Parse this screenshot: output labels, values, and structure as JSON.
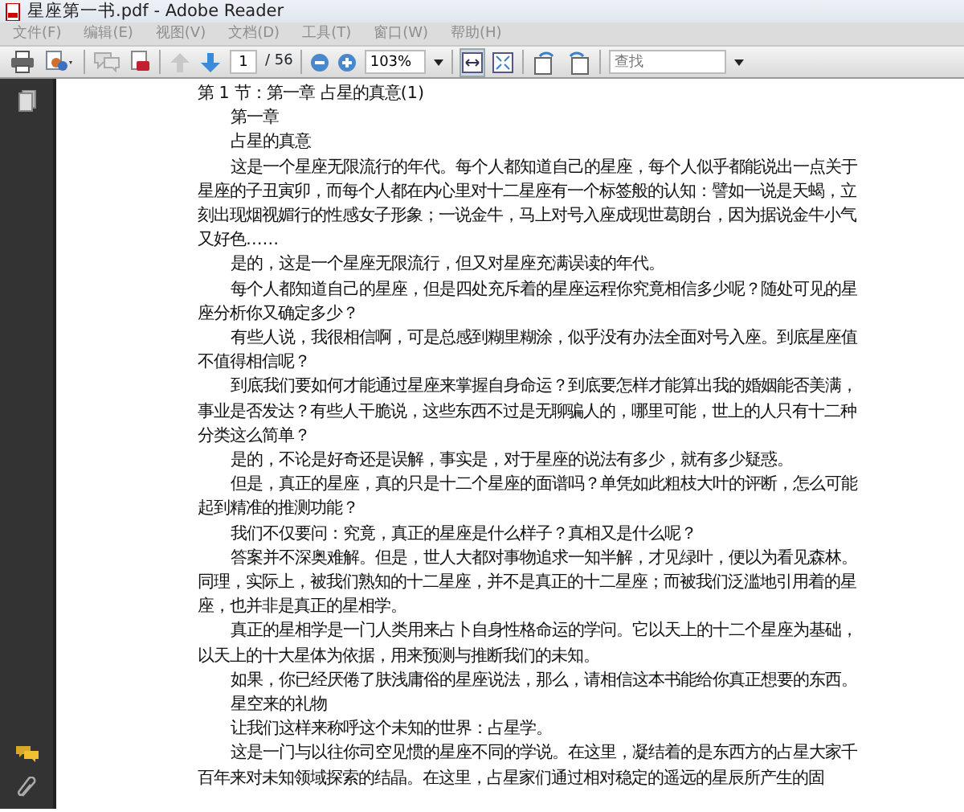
{
  "window": {
    "title": "星座第一书.pdf - Adobe Reader"
  },
  "menu": [
    {
      "label": "文件(F)",
      "disabled": true
    },
    {
      "label": "编辑(E)",
      "disabled": true
    },
    {
      "label": "视图(V)",
      "disabled": true
    },
    {
      "label": "文档(D)",
      "disabled": true
    },
    {
      "label": "工具(T)",
      "disabled": true
    },
    {
      "label": "窗口(W)",
      "disabled": true
    },
    {
      "label": "帮助(H)",
      "disabled": true
    }
  ],
  "toolbar": {
    "page": "1",
    "page_count": "/ 56",
    "zoom": "103%",
    "search": {
      "placeholder": "查找"
    },
    "fit_width_selected": true
  },
  "document": {
    "paragraphs": [
      {
        "kind": "heading",
        "text": "第 1 节：第一章  占星的真意(1)"
      },
      {
        "kind": "para",
        "text": "第一章"
      },
      {
        "kind": "para",
        "text": "占星的真意"
      },
      {
        "kind": "para",
        "text": "这是一个星座无限流行的年代。每个人都知道自己的星座，每个人似乎都能说出一点关于星座的子丑寅卯，而每个人都在内心里对十二星座有一个标签般的认知：譬如一说是天蝎，立刻出现烟视媚行的性感女子形象；一说金牛，马上对号入座成现世葛朗台，因为据说金牛小气又好色……"
      },
      {
        "kind": "para",
        "text": "是的，这是一个星座无限流行，但又对星座充满误读的年代。"
      },
      {
        "kind": "para",
        "text": "每个人都知道自己的星座，但是四处充斥着的星座运程你究竟相信多少呢？随处可见的星座分析你又确定多少？"
      },
      {
        "kind": "para",
        "text": "有些人说，我很相信啊，可是总感到糊里糊涂，似乎没有办法全面对号入座。到底星座值不值得相信呢？"
      },
      {
        "kind": "para",
        "text": "到底我们要如何才能通过星座来掌握自身命运？到底要怎样才能算出我的婚姻能否美满，事业是否发达？有些人干脆说，这些东西不过是无聊骗人的，哪里可能，世上的人只有十二种分类这么简单？"
      },
      {
        "kind": "para",
        "text": "是的，不论是好奇还是误解，事实是，对于星座的说法有多少，就有多少疑惑。"
      },
      {
        "kind": "para",
        "text": "但是，真正的星座，真的只是十二个星座的面谱吗？单凭如此粗枝大叶的评断，怎么可能起到精准的推测功能？"
      },
      {
        "kind": "para",
        "text": "我们不仅要问：究竟，真正的星座是什么样子？真相又是什么呢？"
      },
      {
        "kind": "para",
        "text": "答案并不深奥难解。但是，世人大都对事物追求一知半解，才见绿叶，便以为看见森林。同理，实际上，被我们熟知的十二星座，并不是真正的十二星座；而被我们泛滥地引用着的星座，也并非是真正的星相学。"
      },
      {
        "kind": "para",
        "text": "真正的星相学是一门人类用来占卜自身性格命运的学问。它以天上的十二个星座为基础，以天上的十大星体为依据，用来预测与推断我们的未知。"
      },
      {
        "kind": "para",
        "text": "如果，你已经厌倦了肤浅庸俗的星座说法，那么，请相信这本书能给你真正想要的东西。"
      },
      {
        "kind": "para",
        "text": "星空来的礼物"
      },
      {
        "kind": "para",
        "text": "让我们这样来称呼这个未知的世界：占星学。"
      },
      {
        "kind": "para",
        "text": "这是一门与以往你司空见惯的星座不同的学说。在这里，凝结着的是东西方的占星大家千百年来对未知领域探索的结晶。在这里，占星家们通过相对稳定的遥远的星辰所产生的固"
      }
    ]
  }
}
